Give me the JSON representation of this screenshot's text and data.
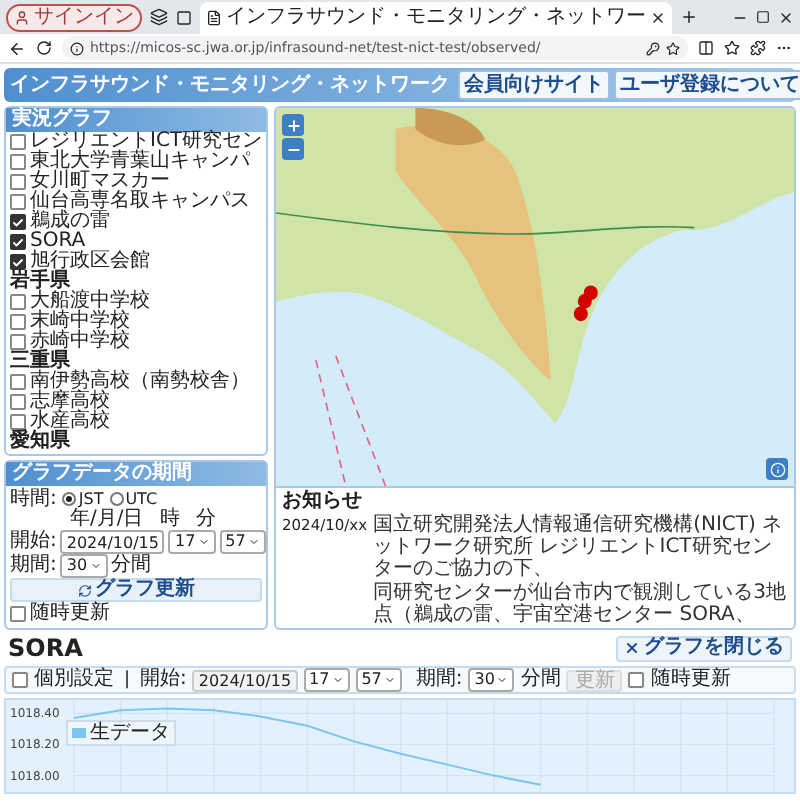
{
  "browser": {
    "profile_button": "サインイン",
    "tab_title": "インフラサウンド・モニタリング・ネットワー",
    "url": "https://micos-sc.jwa.or.jp/infrasound-net/test-nict-test/observed/"
  },
  "header": {
    "title": "インフラサウンド・モニタリング・ネットワーク",
    "buttons": [
      "会員向けサイト",
      "ユーザ登録について"
    ]
  },
  "live_graph": {
    "title": "実況グラフ",
    "items": [
      {
        "kind": "station",
        "label": "レジリエントICT研究セン",
        "checked": false
      },
      {
        "kind": "station",
        "label": "東北大学青葉山キャンパ",
        "checked": false
      },
      {
        "kind": "station",
        "label": "女川町マスカー",
        "checked": false
      },
      {
        "kind": "station",
        "label": "仙台高専名取キャンパス",
        "checked": false
      },
      {
        "kind": "station",
        "label": "鵜成の雷",
        "checked": true
      },
      {
        "kind": "station",
        "label": "SORA",
        "checked": true
      },
      {
        "kind": "station",
        "label": "旭行政区会館",
        "checked": true
      },
      {
        "kind": "group",
        "label": "岩手県"
      },
      {
        "kind": "station",
        "label": "大船渡中学校",
        "checked": false
      },
      {
        "kind": "station",
        "label": "末崎中学校",
        "checked": false
      },
      {
        "kind": "station",
        "label": "赤崎中学校",
        "checked": false
      },
      {
        "kind": "group",
        "label": "三重県"
      },
      {
        "kind": "station",
        "label": "南伊勢高校（南勢校舎）",
        "checked": false
      },
      {
        "kind": "station",
        "label": "志摩高校",
        "checked": false
      },
      {
        "kind": "station",
        "label": "水産高校",
        "checked": false
      },
      {
        "kind": "group",
        "label": "愛知県"
      }
    ]
  },
  "period": {
    "title": "グラフデータの期間",
    "time_label": "時間:",
    "timezones": [
      {
        "label": "JST",
        "selected": true
      },
      {
        "label": "UTC",
        "selected": false
      }
    ],
    "column_headers": [
      "年/月/日",
      "時",
      "分"
    ],
    "start_label": "開始:",
    "start_date": "2024/10/15",
    "start_hour": "17",
    "start_minute": "57",
    "duration_label": "期間:",
    "duration": "30",
    "duration_unit": "分間",
    "update_button": "グラフ更新",
    "auto_update": {
      "label": "随時更新",
      "checked": false
    }
  },
  "notice": {
    "title": "お知らせ",
    "entries": [
      {
        "date": "2024/10/xx",
        "paragraphs": [
          "国立研究開発法人情報通信研究機構(NICT) ネットワーク研究所 レジリエントICT研究センターのご協力の下、",
          "同研究センターが仙台市内で観測している3地点（鵜成の雷、宇宙空港センター SORA、"
        ]
      }
    ]
  },
  "graph": {
    "title": "SORA",
    "close_button": "グラフを閉じる",
    "controls": {
      "individual": {
        "label": "個別設定",
        "checked": false
      },
      "separator": "|",
      "start_label": "開始:",
      "start_date": "2024/10/15",
      "start_hour": "17",
      "start_minute": "57",
      "duration_label": "期間:",
      "duration": "30",
      "duration_unit": "分間",
      "update_button": "更新",
      "update_disabled": true,
      "auto_update": {
        "label": "随時更新",
        "checked": false
      }
    },
    "chart_data": {
      "type": "line",
      "grid": true,
      "ylim": [
        1017.92,
        1018.46
      ],
      "yticks": [
        {
          "value": 1018.0,
          "label": "1018.00"
        },
        {
          "value": 1018.2,
          "label": "1018.20"
        },
        {
          "value": 1018.4,
          "label": "1018.40"
        }
      ],
      "series": [
        {
          "name": "生データ",
          "color": "#7cc6ee",
          "values": [
            1018.37,
            1018.42,
            1018.43,
            1018.42,
            1018.38,
            1018.32,
            1018.22,
            1018.14,
            1018.07,
            1018.0,
            1017.94,
            null,
            null,
            null,
            null,
            null
          ]
        }
      ]
    }
  }
}
